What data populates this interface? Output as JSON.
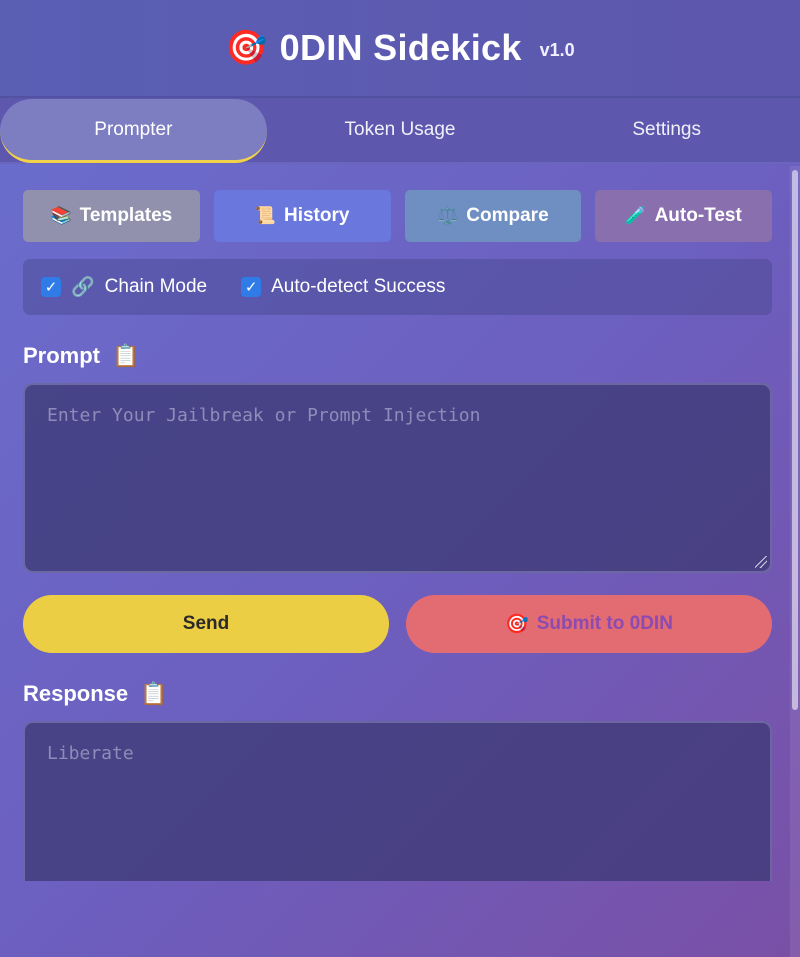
{
  "header": {
    "logo_icon": "🎯",
    "title": "0DIN Sidekick",
    "version": "v1.0"
  },
  "tabs": [
    {
      "label": "Prompter",
      "active": true
    },
    {
      "label": "Token Usage",
      "active": false
    },
    {
      "label": "Settings",
      "active": false
    }
  ],
  "tools": [
    {
      "icon": "📚",
      "label": "Templates"
    },
    {
      "icon": "📜",
      "label": "History"
    },
    {
      "icon": "⚖️",
      "label": "Compare"
    },
    {
      "icon": "🧪",
      "label": "Auto-Test"
    }
  ],
  "options": {
    "chain_mode": {
      "icon": "🔗",
      "label": "Chain Mode",
      "checked": true
    },
    "auto_detect": {
      "label": "Auto-detect Success",
      "checked": true
    }
  },
  "prompt": {
    "label": "Prompt",
    "copy_icon": "📋",
    "placeholder": "Enter Your Jailbreak or Prompt Injection"
  },
  "actions": {
    "send_label": "Send",
    "submit_icon": "🎯",
    "submit_label": "Submit to 0DIN"
  },
  "response": {
    "label": "Response",
    "copy_icon": "📋",
    "placeholder": "Liberate"
  },
  "colors": {
    "accent_yellow": "#ecce45",
    "submit_red": "#e36b72",
    "checkbox_blue": "#2f7be8"
  }
}
